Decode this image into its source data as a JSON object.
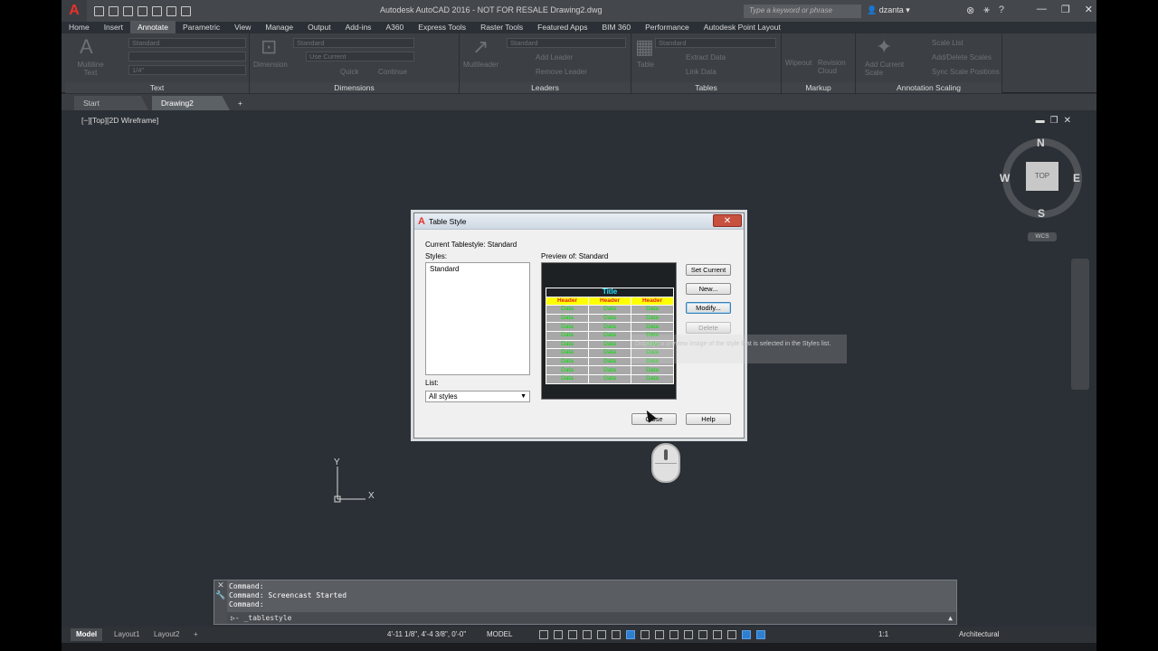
{
  "window": {
    "title": "Autodesk AutoCAD 2016 - NOT FOR RESALE    Drawing2.dwg",
    "search_placeholder": "Type a keyword or phrase",
    "user": "dzanta"
  },
  "ribbon_tabs": [
    "Home",
    "Insert",
    "Annotate",
    "Parametric",
    "View",
    "Manage",
    "Output",
    "Add-ins",
    "A360",
    "Express Tools",
    "Raster Tools",
    "Featured Apps",
    "BIM 360",
    "Performance",
    "Autodesk Point Layout"
  ],
  "ribbon_active_tab": "Annotate",
  "panels": {
    "text": {
      "title": "Text",
      "big_label": "Multiline Text",
      "style": "Standard",
      "height": "1/4\""
    },
    "dimensions": {
      "title": "Dimensions",
      "big_label": "Dimension",
      "style": "Standard",
      "layer": "Use Current",
      "quick": "Quick",
      "continue": "Continue"
    },
    "leaders": {
      "title": "Leaders",
      "big_label": "Multileader",
      "style": "Standard",
      "add": "Add Leader",
      "remove": "Remove Leader"
    },
    "tables": {
      "title": "Tables",
      "big_label": "Table",
      "style": "Standard",
      "extract": "Extract Data",
      "link": "Link Data"
    },
    "markup": {
      "title": "Markup",
      "wipeout": "Wipeout",
      "revcloud": "Revision Cloud"
    },
    "annoscale": {
      "title": "Annotation Scaling",
      "add_scale": "Add Current Scale",
      "scale_list": "Scale List",
      "add_delete": "Add/Delete Scales",
      "sync": "Sync Scale Positions"
    }
  },
  "file_tabs": {
    "start": "Start",
    "drawing": "Drawing2"
  },
  "viewport": {
    "label": "[−][Top][2D Wireframe]"
  },
  "viewcube": {
    "face": "TOP",
    "n": "N",
    "s": "S",
    "e": "E",
    "w": "W",
    "wcs": "WCS"
  },
  "ucs": {
    "x": "X",
    "y": "Y"
  },
  "dialog": {
    "title": "Table Style",
    "current": "Current Tablestyle: Standard",
    "styles_label": "Styles:",
    "styles": [
      "Standard"
    ],
    "list_label": "List:",
    "list_value": "All styles",
    "preview_label": "Preview of: Standard",
    "preview": {
      "title": "Title",
      "header": "Header",
      "data": "Data",
      "data_rows": 9
    },
    "buttons": {
      "set_current": "Set Current",
      "new": "New...",
      "modify": "Modify...",
      "delete": "Delete",
      "close": "Close",
      "help": "Help"
    },
    "tooltip": "Displays a preview image of the style that is selected in the Styles list."
  },
  "command": {
    "history": [
      "Command:",
      "Command: Screencast Started",
      "Command:"
    ],
    "prompt": "_tablestyle"
  },
  "status": {
    "model_tab": "Model",
    "layout1": "Layout1",
    "layout2": "Layout2",
    "coords": "4'-11 1/8\", 4'-4 3/8\", 0'-0\"",
    "model": "MODEL",
    "annoscale": "1:1",
    "units": "Architectural"
  }
}
